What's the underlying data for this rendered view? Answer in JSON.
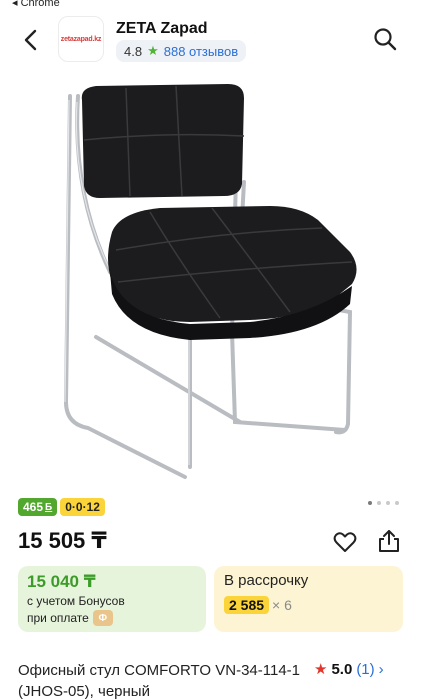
{
  "status_bar": {
    "back_app": "◂ Chrome"
  },
  "shop": {
    "logo_text": "zetazapad.kz",
    "name": "ZETA Zapad",
    "rating": "4.8",
    "reviews": "888 отзывов"
  },
  "gallery": {
    "total_images": 4,
    "current_index": 0
  },
  "badges": {
    "bonus": "465",
    "bonus_unit": "Б",
    "installment": "0·0·12"
  },
  "price": "15 505 ₸",
  "bonus_card": {
    "amount": "15 040 ₸",
    "line1": "с учетом Бонусов",
    "line2": "при оплате",
    "coin": "Ф"
  },
  "installment_card": {
    "title": "В рассрочку",
    "amount": "2 585",
    "multiplier": "× 6"
  },
  "product": {
    "title": "Офисный стул COMFORTO VN-34-114-1 (JHOS-05), черный",
    "rating": "5.0",
    "review_count": "(1)"
  },
  "colors": {
    "accent_green": "#52a82e",
    "accent_yellow": "#fbd43a",
    "link_blue": "#2b6fd6",
    "star_red": "#e2362c"
  }
}
